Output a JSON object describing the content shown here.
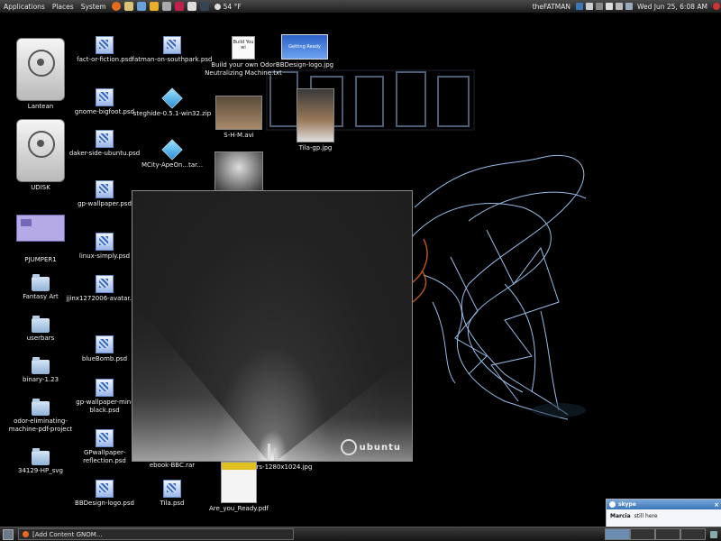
{
  "top_panel": {
    "menus": [
      "Applications",
      "Places",
      "System"
    ],
    "weather_temp": "54 °F",
    "user_name": "theFATMAN",
    "clock": "Wed Jun 25,  6:08 AM"
  },
  "desktop": {
    "col1": [
      {
        "label": "Lantean",
        "kind": "drive"
      },
      {
        "label": "UDISK",
        "kind": "drive"
      },
      {
        "label": "PJUMPER1",
        "kind": "card"
      },
      {
        "label": "Fantasy Art",
        "kind": "folder"
      },
      {
        "label": "userbars",
        "kind": "folder"
      },
      {
        "label": "binary-1.23",
        "kind": "folder"
      },
      {
        "label": "odor-eliminating-machine-pdf-project",
        "kind": "folder"
      },
      {
        "label": "34129-HP_svg",
        "kind": "folder"
      }
    ],
    "col2": [
      {
        "label": "fact-or-fiction.psd"
      },
      {
        "label": "gnome-bigfoot.psd"
      },
      {
        "label": "daker-side-ubuntu.psd"
      },
      {
        "label": "gp-wallpaper.psd"
      },
      {
        "label": "linux-simply.psd"
      },
      {
        "label": "jjinx1272006-avatar.psd"
      },
      {
        "label": "blueBomb.psd"
      },
      {
        "label": "gp-wallpaper-min-black.psd"
      },
      {
        "label": "GPwallpaper-reflection.psd"
      },
      {
        "label": "BBDesign-logo.psd"
      }
    ],
    "col3": [
      {
        "label": "fatman-on-southpark.psd",
        "kind": "psd"
      },
      {
        "label": "steghide-0.5.1-win32.zip",
        "kind": "cube"
      },
      {
        "label": "MCity-ApeOn...tar...",
        "kind": "cube"
      }
    ],
    "col3_bottom": [
      {
        "label": "ebook-BBC.rar"
      },
      {
        "label": "Tila.psd"
      }
    ],
    "col4": [
      {
        "label": "Build your own Odor Neutralizing Machine.txt",
        "thumb_text": "Build You wi"
      },
      {
        "label": "S-H-M.avi"
      },
      {
        "label": "...ors-1280x1024.jpg"
      },
      {
        "label": "Are_you_Ready.pdf"
      }
    ],
    "col5": [
      {
        "label": "BBDesign-logo.jpg",
        "thumb_text": "Getting Ready"
      },
      {
        "label": "Tila-gp.jpg"
      }
    ]
  },
  "splash": {
    "logo_text": "ubuntu"
  },
  "skype_popup": {
    "title": "skype",
    "sender": "Marcia",
    "message": "still here",
    "close": "×"
  },
  "bottom_panel": {
    "task_label": "[Add Content GNOM..."
  },
  "colors": {
    "panel": "#2a2a2a",
    "accent_blue": "#3a76b8",
    "wire": "#8fc4ff",
    "skin_orange": "#d66a1e"
  }
}
